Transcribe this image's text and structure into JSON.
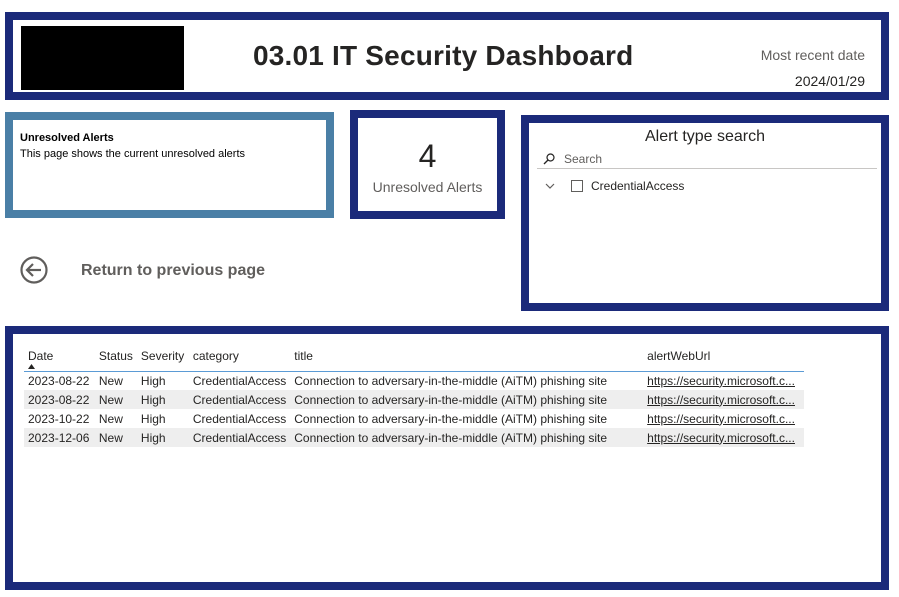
{
  "header": {
    "title": "03.01 IT Security Dashboard",
    "date_label": "Most recent date",
    "date_value": "2024/01/29"
  },
  "info_card": {
    "title": "Unresolved Alerts",
    "description": "This page shows the current unresolved alerts"
  },
  "kpi": {
    "value": "4",
    "label": "Unresolved Alerts"
  },
  "slicer": {
    "title": "Alert type search",
    "search_placeholder": "Search",
    "items": [
      {
        "label": "CredentialAccess",
        "checked": false
      }
    ]
  },
  "back_button": {
    "label": "Return to previous page",
    "icon": "arrow-left-circle-icon"
  },
  "table": {
    "columns": [
      "Date",
      "Status",
      "Severity",
      "category",
      "title",
      "alertWebUrl"
    ],
    "sort_column": "Date",
    "sort_direction": "ascending",
    "rows": [
      [
        "2023-08-22",
        "New",
        "High",
        "CredentialAccess",
        "Connection to adversary-in-the-middle (AiTM) phishing site",
        "https://security.microsoft.c..."
      ],
      [
        "2023-08-22",
        "New",
        "High",
        "CredentialAccess",
        "Connection to adversary-in-the-middle (AiTM) phishing site",
        "https://security.microsoft.c..."
      ],
      [
        "2023-10-22",
        "New",
        "High",
        "CredentialAccess",
        "Connection to adversary-in-the-middle (AiTM) phishing site",
        "https://security.microsoft.c..."
      ],
      [
        "2023-12-06",
        "New",
        "High",
        "CredentialAccess",
        "Connection to adversary-in-the-middle (AiTM) phishing site",
        "https://security.microsoft.c..."
      ]
    ]
  },
  "colors": {
    "panel_border": "#1b2a7a",
    "info_border": "#4a7fa6",
    "row_alt": "#eeeeee",
    "header_rule": "#5b9bd5"
  }
}
